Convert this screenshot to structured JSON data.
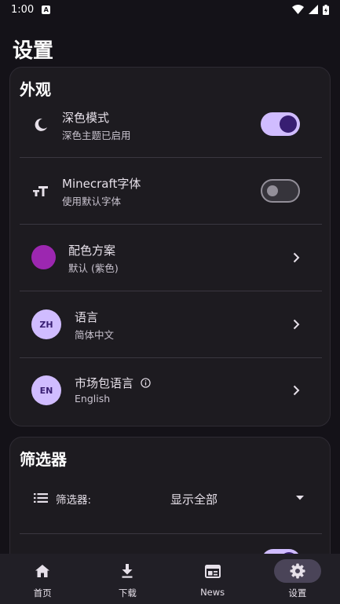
{
  "status_bar": {
    "time": "1:00",
    "notif_letter": "A"
  },
  "page": {
    "title": "设置"
  },
  "appearance": {
    "title": "外观",
    "dark_mode": {
      "title": "深色模式",
      "subtitle": "深色主题已启用",
      "enabled": true,
      "icon": "moon-icon"
    },
    "minecraft_font": {
      "title": "Minecraft字体",
      "subtitle": "使用默认字体",
      "enabled": false,
      "icon": "text-size-icon"
    },
    "color_scheme": {
      "title": "配色方案",
      "subtitle": "默认 (紫色)",
      "color": "#9C27B0"
    },
    "language": {
      "title": "语言",
      "subtitle": "简体中文",
      "badge": "ZH"
    },
    "market_language": {
      "title": "市场包语言",
      "subtitle": "English",
      "badge": "EN",
      "icon": "info-icon"
    }
  },
  "filter": {
    "title": "筛选器",
    "label": "筛选器:",
    "value": "显示全部",
    "icon": "list-icon"
  },
  "bottom_nav": {
    "items": [
      {
        "label": "首页",
        "icon": "home-icon"
      },
      {
        "label": "下载",
        "icon": "download-icon"
      },
      {
        "label": "News",
        "icon": "news-icon"
      },
      {
        "label": "设置",
        "icon": "gear-icon",
        "active": true
      }
    ]
  },
  "colors": {
    "accent": "#D0BCFF",
    "accent_dark": "#381E72",
    "background": "#141218",
    "card": "#1D1B20"
  }
}
